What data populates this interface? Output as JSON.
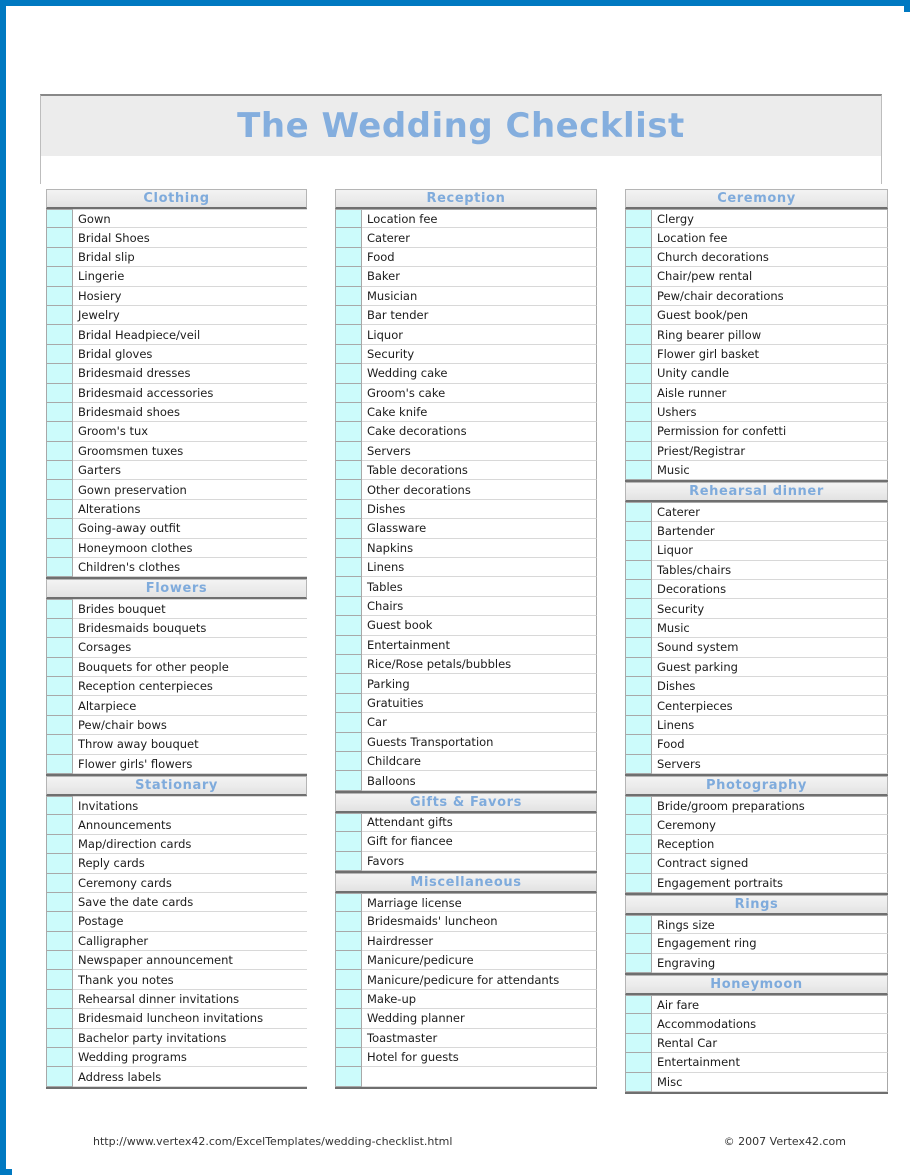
{
  "document": {
    "title": "The Wedding Checklist",
    "accent_color": "#84aede",
    "checkbox_color": "#ccfbfb",
    "header_bg": "#ececec"
  },
  "footer": {
    "url": "http://www.vertex42.com/ExcelTemplates/wedding-checklist.html",
    "copyright": "© 2007 Vertex42.com"
  },
  "columns": [
    {
      "name": "column-1",
      "sections": [
        {
          "title": "Clothing",
          "items": [
            "Gown",
            "Bridal Shoes",
            "Bridal slip",
            "Lingerie",
            "Hosiery",
            "Jewelry",
            "Bridal Headpiece/veil",
            "Bridal gloves",
            "Bridesmaid dresses",
            "Bridesmaid accessories",
            "Bridesmaid shoes",
            "Groom's tux",
            "Groomsmen tuxes",
            "Garters",
            "Gown preservation",
            "Alterations",
            "Going-away outfit",
            "Honeymoon clothes",
            "Children's clothes"
          ]
        },
        {
          "title": "Flowers",
          "items": [
            "Brides bouquet",
            "Bridesmaids bouquets",
            "Corsages",
            "Bouquets for other people",
            "Reception centerpieces",
            "Altarpiece",
            "Pew/chair bows",
            "Throw away bouquet",
            "Flower girls' flowers"
          ]
        },
        {
          "title": "Stationary",
          "items": [
            "Invitations",
            "Announcements",
            "Map/direction cards",
            "Reply cards",
            "Ceremony cards",
            "Save the date cards",
            "Postage",
            "Calligrapher",
            "Newspaper announcement",
            "Thank you notes",
            "Rehearsal dinner invitations",
            "Bridesmaid luncheon invitations",
            "Bachelor party invitations",
            "Wedding programs",
            "Address labels"
          ]
        }
      ]
    },
    {
      "name": "column-2",
      "sections": [
        {
          "title": "Reception",
          "items": [
            "Location fee",
            "Caterer",
            "Food",
            "Baker",
            "Musician",
            "Bar tender",
            "Liquor",
            "Security",
            "Wedding cake",
            "Groom's cake",
            "Cake knife",
            "Cake decorations",
            "Servers",
            "Table decorations",
            "Other decorations",
            "Dishes",
            "Glassware",
            "Napkins",
            "Linens",
            "Tables",
            "Chairs",
            "Guest book",
            "Entertainment",
            "Rice/Rose petals/bubbles",
            "Parking",
            "Gratuities",
            "Car",
            "Guests Transportation",
            "Childcare",
            "Balloons"
          ]
        },
        {
          "title": "Gifts & Favors",
          "items": [
            "Attendant gifts",
            "Gift for fiancee",
            "Favors"
          ]
        },
        {
          "title": "Miscellaneous",
          "items": [
            "Marriage license",
            "Bridesmaids' luncheon",
            "Hairdresser",
            "Manicure/pedicure",
            "Manicure/pedicure for attendants",
            "Make-up",
            "Wedding planner",
            "Toastmaster",
            "Hotel for guests",
            ""
          ]
        }
      ]
    },
    {
      "name": "column-3",
      "sections": [
        {
          "title": "Ceremony",
          "items": [
            "Clergy",
            "Location fee",
            "Church decorations",
            "Chair/pew rental",
            "Pew/chair decorations",
            "Guest book/pen",
            "Ring bearer pillow",
            "Flower girl basket",
            "Unity candle",
            "Aisle runner",
            "Ushers",
            "Permission for confetti",
            "Priest/Registrar",
            "Music"
          ]
        },
        {
          "title": "Rehearsal dinner",
          "items": [
            "Caterer",
            "Bartender",
            "Liquor",
            "Tables/chairs",
            "Decorations",
            "Security",
            "Music",
            "Sound system",
            "Guest parking",
            "Dishes",
            "Centerpieces",
            "Linens",
            "Food",
            "Servers"
          ]
        },
        {
          "title": "Photography",
          "items": [
            "Bride/groom preparations",
            "Ceremony",
            "Reception",
            "Contract signed",
            "Engagement portraits"
          ]
        },
        {
          "title": "Rings",
          "items": [
            "Rings size",
            "Engagement ring",
            "Engraving"
          ]
        },
        {
          "title": "Honeymoon",
          "items": [
            "Air fare",
            "Accommodations",
            "Rental Car",
            "Entertainment",
            "Misc"
          ]
        }
      ]
    }
  ]
}
